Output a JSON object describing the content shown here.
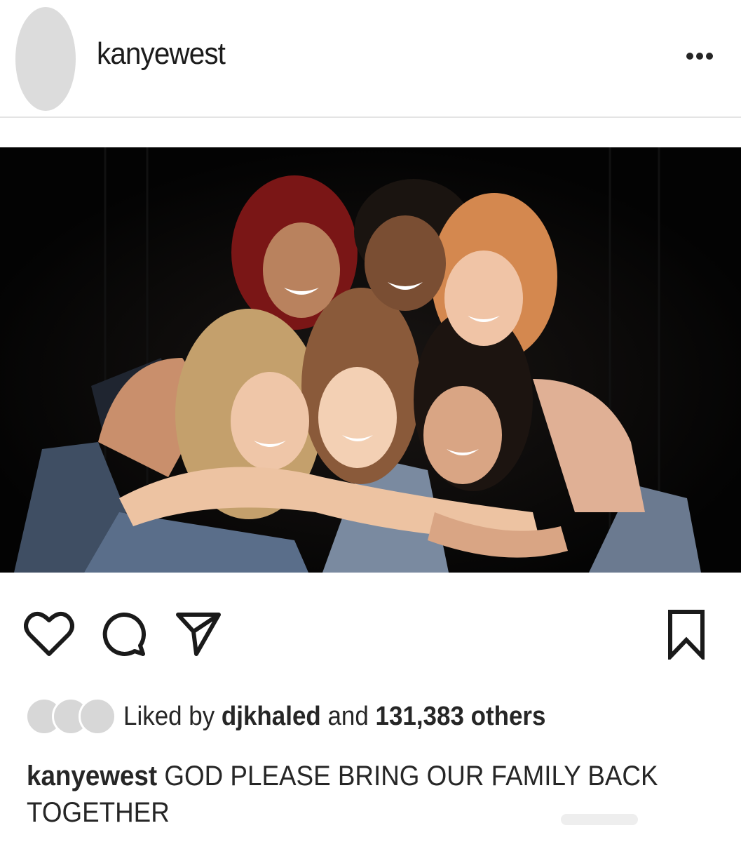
{
  "post": {
    "username": "kanyewest",
    "more_options_icon": "more-horizontal-icon"
  },
  "photo": {
    "description_colors": {
      "background": "#050505",
      "skin": "#d9a27f",
      "hair_red": "#8a1f1f",
      "hair_ginger": "#d98d55",
      "hair_blonde": "#c9a874",
      "denim": "#4a5a70"
    }
  },
  "actions": {
    "like_icon": "heart-icon",
    "comment_icon": "comment-icon",
    "share_icon": "send-icon",
    "save_icon": "bookmark-icon"
  },
  "likes": {
    "prefix": "Liked by ",
    "liker": "djkhaled",
    "middle": " and ",
    "count": "131,383 others"
  },
  "caption": {
    "username": "kanyewest",
    "text": " GOD PLEASE BRING OUR FAMILY BACK TOGETHER"
  }
}
